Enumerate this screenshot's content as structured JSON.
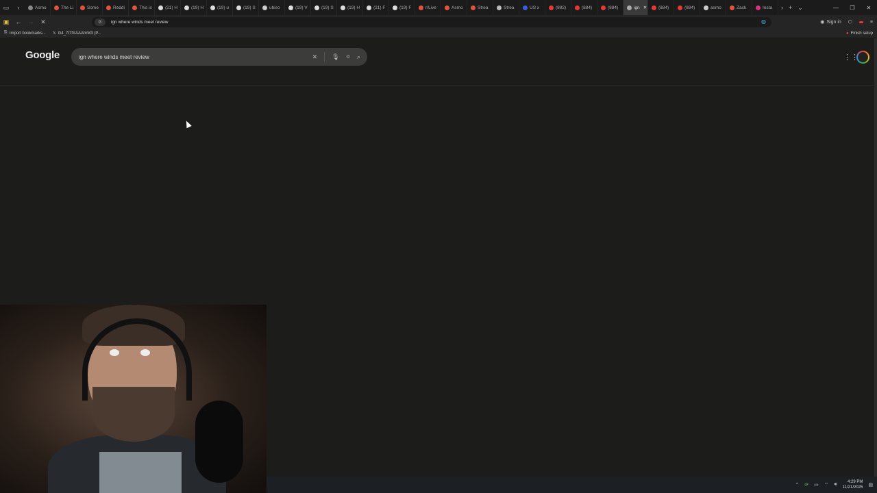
{
  "tabs": [
    {
      "label": "Asmo",
      "color": "#888888"
    },
    {
      "label": "The Li",
      "color": "#e0523c"
    },
    {
      "label": "Some",
      "color": "#e0523c"
    },
    {
      "label": "Reddi",
      "color": "#e0523c"
    },
    {
      "label": "This is",
      "color": "#e0523c"
    },
    {
      "label": "(21) H",
      "color": "#dddddd"
    },
    {
      "label": "(19) H",
      "color": "#dddddd"
    },
    {
      "label": "(19) u",
      "color": "#dddddd"
    },
    {
      "label": "(19) S",
      "color": "#dddddd"
    },
    {
      "label": "ubiso",
      "color": "#cccccc"
    },
    {
      "label": "(19) V",
      "color": "#dddddd"
    },
    {
      "label": "(19) S",
      "color": "#dddddd"
    },
    {
      "label": "(19) H",
      "color": "#dddddd"
    },
    {
      "label": "(21) F",
      "color": "#dddddd"
    },
    {
      "label": "(19) F",
      "color": "#dddddd"
    },
    {
      "label": "r/Live",
      "color": "#e0523c"
    },
    {
      "label": "Asmo",
      "color": "#e0523c"
    },
    {
      "label": "Strea",
      "color": "#e0523c"
    },
    {
      "label": "Strea",
      "color": "#bbbbbb"
    },
    {
      "label": "US x",
      "color": "#3b5bdb"
    },
    {
      "label": "(882)",
      "color": "#e53935"
    },
    {
      "label": "(884)",
      "color": "#e53935"
    },
    {
      "label": "(884)",
      "color": "#e53935"
    },
    {
      "label": "ign",
      "color": "#aaaaaa",
      "active": true
    },
    {
      "label": "(884)",
      "color": "#e53935"
    },
    {
      "label": "(884)",
      "color": "#e53935"
    },
    {
      "label": "asmo",
      "color": "#cccccc"
    },
    {
      "label": "Zack",
      "color": "#e0523c"
    },
    {
      "label": "Insta",
      "color": "#d63384"
    }
  ],
  "address_bar": {
    "url": "ign where winds meet review"
  },
  "toolbar": {
    "sign_in": "Sign in"
  },
  "bookmarks": {
    "import": "Import bookmarks...",
    "item": "G4_7t7fXAAAhrM3 (P...",
    "finish_setup": "Finish setup"
  },
  "google": {
    "logo": "Google",
    "query": "ign where winds meet review"
  },
  "taskbar": {
    "time": "4:29 PM",
    "date": "11/21/2025"
  }
}
